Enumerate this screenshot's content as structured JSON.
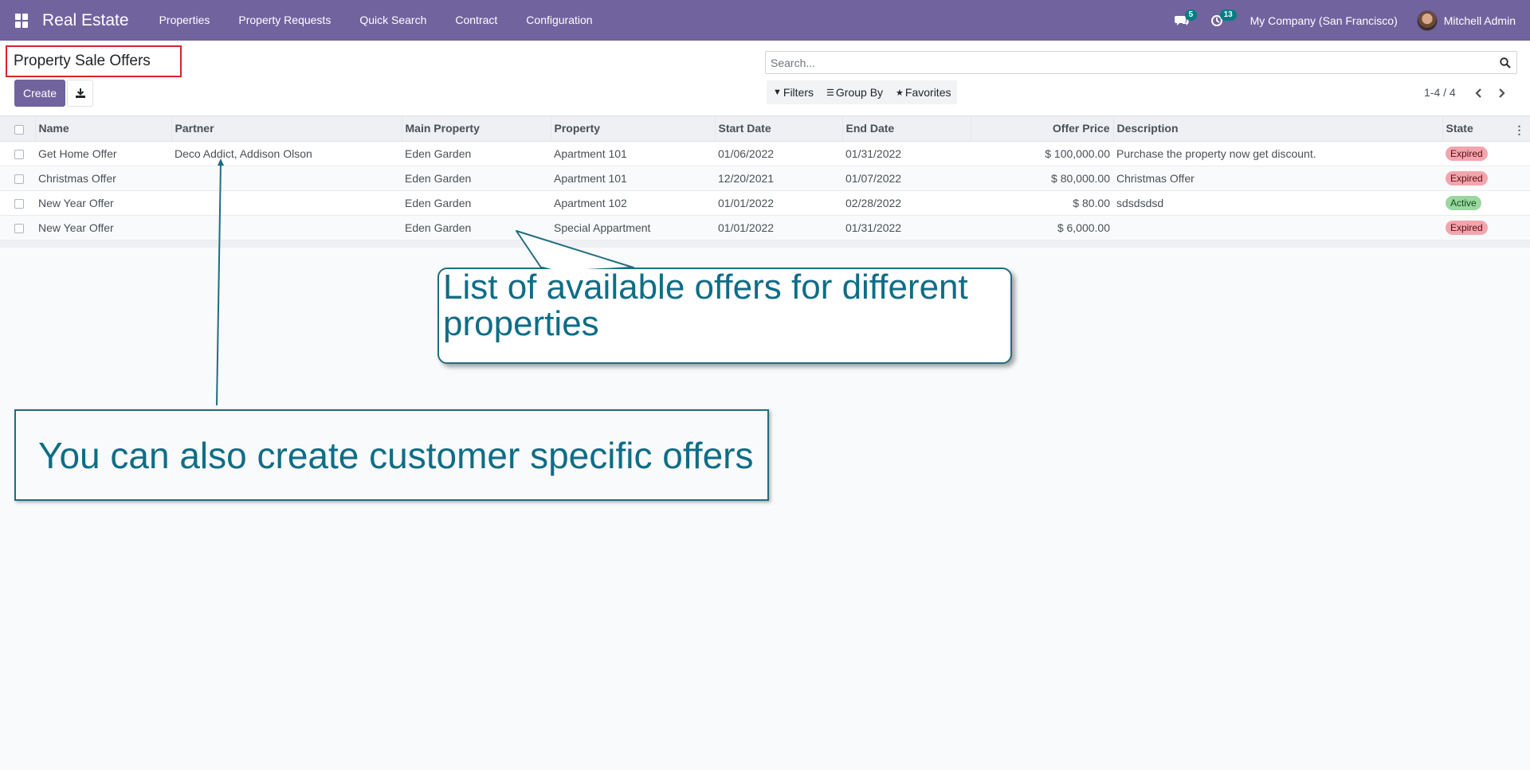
{
  "navbar": {
    "app_name": "Real Estate",
    "menu": [
      "Properties",
      "Property Requests",
      "Quick Search",
      "Contract",
      "Configuration"
    ],
    "messages_count": "5",
    "activities_count": "13",
    "company": "My Company (San Francisco)",
    "user": "Mitchell Admin"
  },
  "control_panel": {
    "title": "Property Sale Offers",
    "create_label": "Create",
    "search_placeholder": "Search...",
    "filters_label": "Filters",
    "group_by_label": "Group By",
    "favorites_label": "Favorites",
    "pager": "1-4 / 4"
  },
  "table": {
    "columns": [
      "Name",
      "Partner",
      "Main Property",
      "Property",
      "Start Date",
      "End Date",
      "Offer Price",
      "Description",
      "State"
    ],
    "rows": [
      {
        "name": "Get Home Offer",
        "partner": "Deco Addict, Addison Olson",
        "main_property": "Eden Garden",
        "property": "Apartment 101",
        "start_date": "01/06/2022",
        "end_date": "01/31/2022",
        "offer_price": "$ 100,000.00",
        "description": "Purchase the property now get discount.",
        "state": "Expired"
      },
      {
        "name": "Christmas Offer",
        "partner": "",
        "main_property": "Eden Garden",
        "property": "Apartment 101",
        "start_date": "12/20/2021",
        "end_date": "01/07/2022",
        "offer_price": "$ 80,000.00",
        "description": "Christmas Offer",
        "state": "Expired"
      },
      {
        "name": "New Year Offer",
        "partner": "",
        "main_property": "Eden Garden",
        "property": "Apartment 102",
        "start_date": "01/01/2022",
        "end_date": "02/28/2022",
        "offer_price": "$ 80.00",
        "description": "sdsdsdsd",
        "state": "Active"
      },
      {
        "name": "New Year Offer",
        "partner": "",
        "main_property": "Eden Garden",
        "property": "Special Appartment",
        "start_date": "01/01/2022",
        "end_date": "01/31/2022",
        "offer_price": "$ 6,000.00",
        "description": "",
        "state": "Expired"
      }
    ]
  },
  "annotations": {
    "callout": "List of available offers for different properties",
    "note": "You can also create customer specific offers",
    "accent_color": "#0e6d87"
  },
  "colors": {
    "brand": "#71639e",
    "badge": "#017e84",
    "expired": "#f3a5ad",
    "active": "#9bd7a0"
  }
}
